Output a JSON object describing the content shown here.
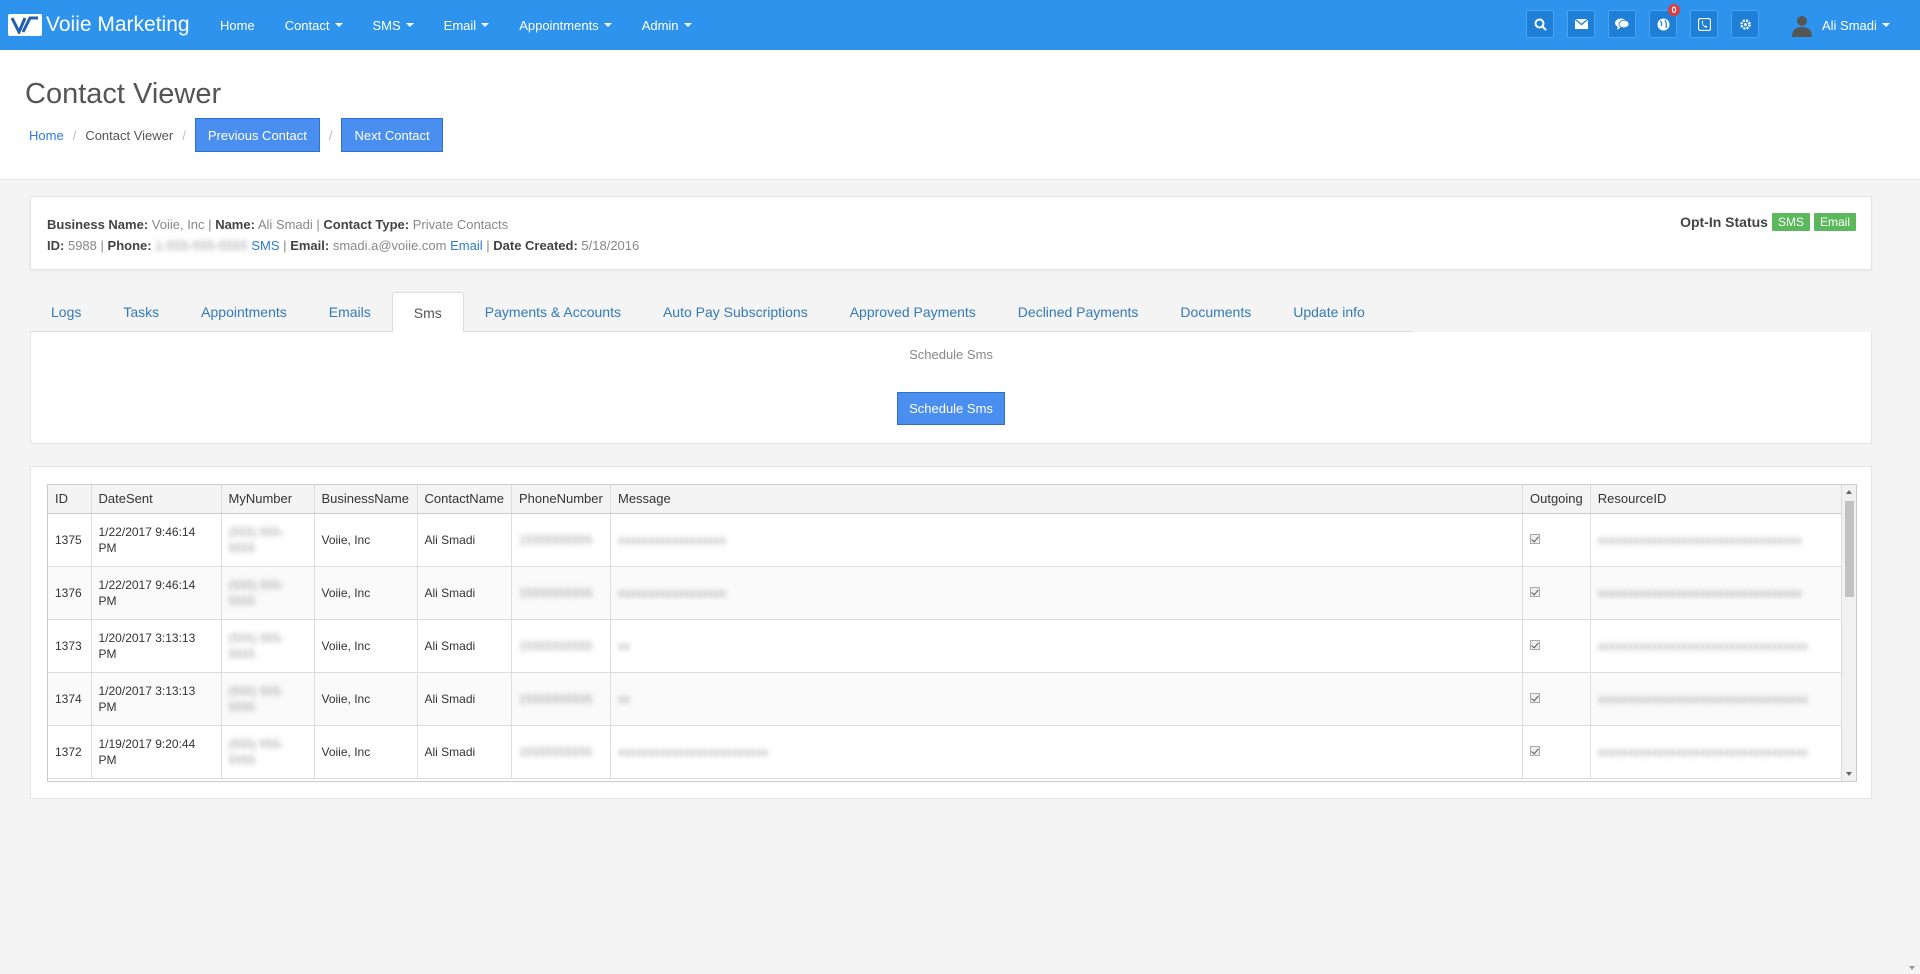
{
  "brand": {
    "name": "Voiie Marketing"
  },
  "nav": [
    {
      "label": "Home",
      "caret": false
    },
    {
      "label": "Contact",
      "caret": true
    },
    {
      "label": "SMS",
      "caret": true
    },
    {
      "label": "Email",
      "caret": true
    },
    {
      "label": "Appointments",
      "caret": true
    },
    {
      "label": "Admin",
      "caret": true
    }
  ],
  "nav_icons": [
    "search-icon",
    "envelope-icon",
    "chat-icon",
    "globe-icon",
    "phone-icon",
    "gear-icon"
  ],
  "notification_count": "0",
  "user": {
    "name": "Ali Smadi"
  },
  "header": {
    "title": "Contact Viewer",
    "breadcrumb_home": "Home",
    "breadcrumb_current": "Contact Viewer",
    "prev_button": "Previous Contact",
    "next_button": "Next Contact",
    "sep": "/"
  },
  "info": {
    "business_label": "Business Name:",
    "business_value": "Voiie, Inc",
    "name_label": "Name:",
    "name_value": "Ali Smadi",
    "type_label": "Contact Type:",
    "type_value": "Private Contacts",
    "id_label": "ID:",
    "id_value": "5988",
    "phone_label": "Phone:",
    "phone_value": "1-555-555-5555",
    "sms_link": "SMS",
    "email_label": "Email",
    "email_value": "smadi.a@voiie.com",
    "email_link": "Email",
    "created_label": "Date Created:",
    "created_value": "5/18/2016",
    "divider": "|",
    "optin_label": "Opt-In Status",
    "optin_sms": "SMS",
    "optin_email": "Email"
  },
  "tabs": [
    {
      "label": "Logs",
      "active": false
    },
    {
      "label": "Tasks",
      "active": false
    },
    {
      "label": "Appointments",
      "active": false
    },
    {
      "label": "Emails",
      "active": false
    },
    {
      "label": "Sms",
      "active": true
    },
    {
      "label": "Payments & Accounts",
      "active": false
    },
    {
      "label": "Auto Pay Subscriptions",
      "active": false
    },
    {
      "label": "Approved Payments",
      "active": false
    },
    {
      "label": "Declined Payments",
      "active": false
    },
    {
      "label": "Documents",
      "active": false
    },
    {
      "label": "Update info",
      "active": false
    }
  ],
  "schedule": {
    "title": "Schedule Sms",
    "button": "Schedule Sms"
  },
  "table": {
    "columns": [
      "ID",
      "DateSent",
      "MyNumber",
      "BusinessName",
      "ContactName",
      "PhoneNumber",
      "Message",
      "Outgoing",
      "ResourceID"
    ],
    "rows": [
      {
        "id": "1375",
        "date": "1/22/2017 9:46:14 PM",
        "my_number": "(555) 555-5555",
        "business": "Voiie, Inc",
        "contact": "Ali Smadi",
        "phone": "15555555555",
        "message": "xxxxxxxxxxxxxxxxxx",
        "outgoing": true,
        "resource": "xxxxxxxxxxxxxxxxxxxxxxxxxxxxxxxxxx"
      },
      {
        "id": "1376",
        "date": "1/22/2017 9:46:14 PM",
        "my_number": "(555) 555-5555",
        "business": "Voiie, Inc",
        "contact": "Ali Smadi",
        "phone": "15555555555",
        "message": "xxxxxxxxxxxxxxxxxx",
        "outgoing": true,
        "resource": "xxxxxxxxxxxxxxxxxxxxxxxxxxxxxxxxxx"
      },
      {
        "id": "1373",
        "date": "1/20/2017 3:13:13 PM",
        "my_number": "(555) 555-5555",
        "business": "Voiie, Inc",
        "contact": "Ali Smadi",
        "phone": "15555555555",
        "message": "xx",
        "outgoing": true,
        "resource": "xxxxxxxxxxxxxxxxxxxxxxxxxxxxxxxxxxx"
      },
      {
        "id": "1374",
        "date": "1/20/2017 3:13:13 PM",
        "my_number": "(555) 555-5555",
        "business": "Voiie, Inc",
        "contact": "Ali Smadi",
        "phone": "15555555555",
        "message": "xx",
        "outgoing": true,
        "resource": "xxxxxxxxxxxxxxxxxxxxxxxxxxxxxxxxxxx"
      },
      {
        "id": "1372",
        "date": "1/19/2017 9:20:44 PM",
        "my_number": "(555) 555-5555",
        "business": "Voiie, Inc",
        "contact": "Ali Smadi",
        "phone": "15555555555",
        "message": "xxxxxxxxxxxxxxxxxxxxxxxxx",
        "outgoing": true,
        "resource": "xxxxxxxxxxxxxxxxxxxxxxxxxxxxxxxxxxx"
      }
    ]
  }
}
